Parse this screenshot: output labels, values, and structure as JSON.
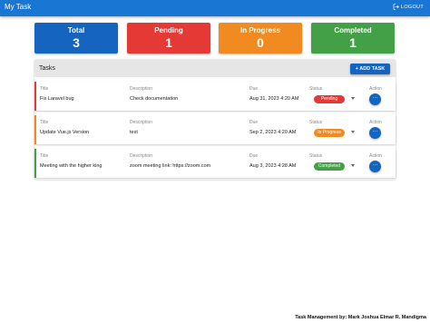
{
  "topbar": {
    "title": "My Task",
    "logout_label": "LOGOUT"
  },
  "cards": [
    {
      "label": "Total",
      "count": "3",
      "color": "#1565c0"
    },
    {
      "label": "Pending",
      "count": "1",
      "color": "#e53935"
    },
    {
      "label": "In Progress",
      "count": "0",
      "color": "#f28a22"
    },
    {
      "label": "Completed",
      "count": "1",
      "color": "#43a047"
    }
  ],
  "tasks": {
    "heading": "Tasks",
    "add_label": "ADD TASK",
    "columns": {
      "title": "Title",
      "description": "Description",
      "due": "Due",
      "status": "Status",
      "action": "Action"
    },
    "rows": [
      {
        "title": "Fix Laravel bug",
        "description": "Check documentation",
        "due": "Aug 31, 2023 4:20 AM",
        "status": "Pending",
        "status_color": "#e53935",
        "accent_color": "#e53935"
      },
      {
        "title": "Update Vue.js Version",
        "description": "test",
        "due": "Sep 2, 2023 4:20 AM",
        "status": "In Progress",
        "status_color": "#f28a22",
        "accent_color": "#f28a22"
      },
      {
        "title": "Meeting with the higher king",
        "description": "zoom meeting link: https://zoom.com",
        "due": "Aug 3, 2023 4:28 AM",
        "status": "Completed",
        "status_color": "#43a047",
        "accent_color": "#43a047"
      }
    ]
  },
  "footer": {
    "text": "Task Management by: Mark Joshua Elmar R. Mandigma"
  }
}
